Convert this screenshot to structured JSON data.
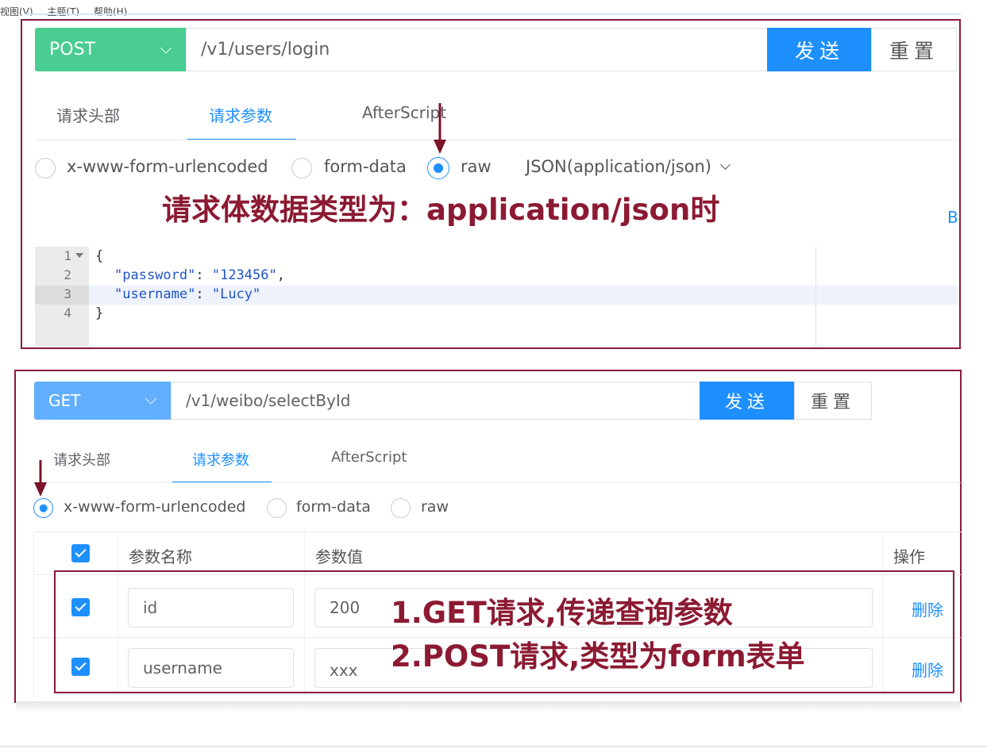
{
  "menu": {
    "items": [
      "视图(V)",
      "主题(T)",
      "帮助(H)"
    ]
  },
  "colors": {
    "primary": "#1e8fff",
    "post_method": "#49cc90",
    "get_method": "#61affe",
    "annotation": "#8b1a32"
  },
  "panel1": {
    "method": "POST",
    "url": "/v1/users/login",
    "send_label": "发送",
    "reset_label": "重置",
    "tabs": [
      "请求头部",
      "请求参数",
      "AfterScript"
    ],
    "active_tab": "请求参数",
    "body_types": [
      "x-www-form-urlencoded",
      "form-data",
      "raw"
    ],
    "selected_body_type": "raw",
    "content_type": "JSON(application/json)",
    "annotation": "请求体数据类型为：application/json时",
    "side_letter": "B",
    "code": {
      "line_numbers": [
        "1",
        "2",
        "3",
        "4"
      ],
      "open_brace": "{",
      "close_brace": "}",
      "key1": "\"password\"",
      "val1": "\"123456\"",
      "key2": "\"username\"",
      "val2": "\"Lucy\""
    }
  },
  "panel2": {
    "method": "GET",
    "url": "/v1/weibo/selectById",
    "send_label": "发送",
    "reset_label": "重置",
    "tabs": [
      "请求头部",
      "请求参数",
      "AfterScript"
    ],
    "active_tab": "请求参数",
    "body_types": [
      "x-www-form-urlencoded",
      "form-data",
      "raw"
    ],
    "selected_body_type": "x-www-form-urlencoded",
    "table": {
      "headers": [
        "参数名称",
        "参数值",
        "操作"
      ],
      "rows": [
        {
          "checked": true,
          "name": "id",
          "value": "200",
          "action": "删除"
        },
        {
          "checked": true,
          "name": "username",
          "value": "xxx",
          "action": "删除"
        }
      ]
    },
    "annotation_lines": [
      "1.GET请求,传递查询参数",
      "2.POST请求,类型为form表单"
    ]
  }
}
